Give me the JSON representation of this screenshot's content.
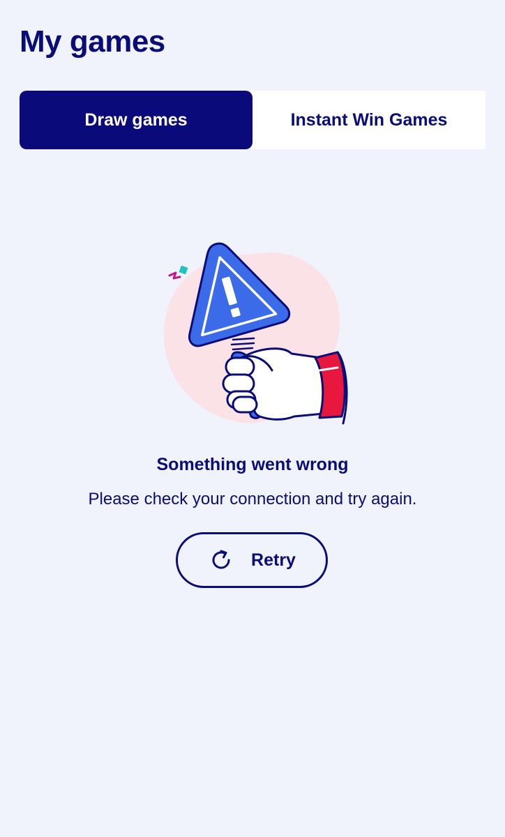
{
  "header": {
    "title": "My games"
  },
  "tabs": [
    {
      "label": "Draw games",
      "active": true
    },
    {
      "label": "Instant Win Games",
      "active": false
    }
  ],
  "error": {
    "illustration": "warning-sign-hand",
    "title": "Something went wrong",
    "message": "Please check your connection and try again.",
    "retry_label": "Retry",
    "retry_icon": "refresh-icon"
  },
  "colors": {
    "background": "#f0f3fb",
    "primary_navy": "#0a0c78",
    "accent_blue": "#3b6be8",
    "accent_red": "#e8173d",
    "blob_pink": "#fbe2e6"
  }
}
